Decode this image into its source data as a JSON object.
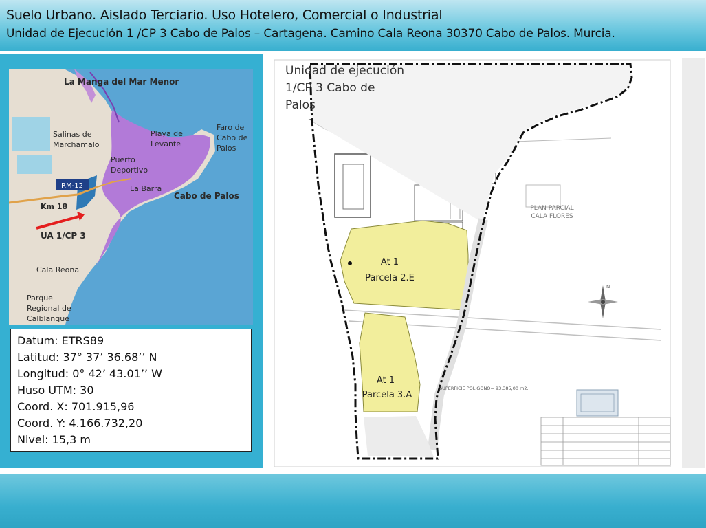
{
  "header": {
    "title": "Suelo Urbano. Aislado Terciario. Uso Hotelero, Comercial o Industrial",
    "subtitle": "Unidad de Ejecución 1 /CP 3 Cabo de Palos – Cartagena. Camino Cala Reona 30370 Cabo de Palos. Murcia."
  },
  "location_map": {
    "labels": {
      "la_manga": "La Manga del Mar Menor",
      "salinas_1": "Salinas de",
      "salinas_2": "Marchamalo",
      "playa_1": "Playa de",
      "playa_2": "Levante",
      "faro_1": "Faro de",
      "faro_2": "Cabo de",
      "faro_3": "Palos",
      "puerto_1": "Puerto",
      "puerto_2": "Deportivo",
      "la_barra": "La Barra",
      "cabo_de_palos": "Cabo de Palos",
      "rm12": "RM-12",
      "km18": "Km 18",
      "ua": "UA 1/CP 3",
      "cala_reona": "Cala Reona",
      "parque_1": "Parque",
      "parque_2": "Regional de",
      "parque_3": "Calblanque"
    }
  },
  "info": {
    "datum": "Datum: ETRS89",
    "latitud": "Latitud: 37° 37’ 36.68’’ N",
    "longitud": "Longitud: 0° 42’ 43.01’’ W",
    "huso": "Huso UTM: 30",
    "coord_x": "Coord. X: 701.915,96",
    "coord_y": "Coord. Y: 4.166.732,20",
    "nivel": "Nivel: 15,3 m"
  },
  "plan": {
    "title_1": "Unidad de ejecución",
    "title_2": "1/CP 3 Cabo de",
    "title_3": "Palos",
    "parcela_2e_1": "At 1",
    "parcela_2e_2": "Parcela 2.E",
    "parcela_3a_1": "At 1",
    "parcela_3a_2": "Parcela 3.A",
    "plan_parcial_1": "PLAN PARCIAL",
    "plan_parcial_2": "CALA FLORES",
    "superficie": "SUPERFICIE POLIGONO= 93.385,00 m2.",
    "north": "N"
  },
  "colors": {
    "header": "#6fc9e0",
    "panel": "#35b0d2",
    "parcel": "#f2ee9c",
    "sea": "#5aa5d4",
    "urban": "#b27ad8"
  }
}
